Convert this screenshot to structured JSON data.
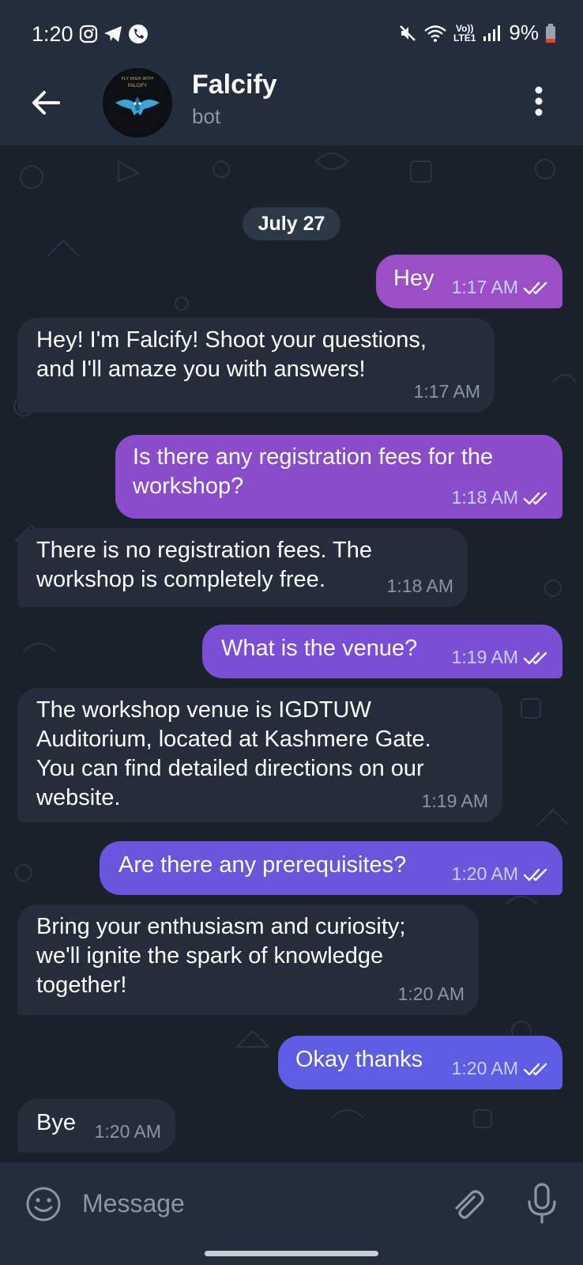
{
  "status_bar": {
    "time": "1:20",
    "battery": "9%",
    "network_top": "Vo))",
    "network_bottom": "LTE1"
  },
  "header": {
    "title": "Falcify",
    "subtitle": "bot",
    "avatar_text_line1": "FLY HIGH WITH",
    "avatar_text_line2": "FALCIFY"
  },
  "chat": {
    "date": "July 27",
    "messages": [
      {
        "direction": "out",
        "text": "Hey",
        "time": "1:17 AM",
        "color": "#9a4fc7"
      },
      {
        "direction": "in",
        "lines": [
          "Hey! I'm Falcify! Shoot your questions,",
          "and I'll amaze you with answers!"
        ],
        "time": "1:17 AM"
      },
      {
        "direction": "out",
        "lines": [
          "Is there any registration fees for the",
          "workshop?"
        ],
        "time": "1:18 AM",
        "color": "#8a4ccb"
      },
      {
        "direction": "in",
        "lines": [
          "There is no registration fees. The",
          "workshop is completely free."
        ],
        "time": "1:18 AM"
      },
      {
        "direction": "out",
        "text": "What is the venue?",
        "time": "1:19 AM",
        "color": "#7a4fd6"
      },
      {
        "direction": "in",
        "lines": [
          "The workshop venue is IGDTUW",
          "Auditorium, located at Kashmere Gate.",
          "You can find detailed directions on our",
          "website."
        ],
        "time": "1:19 AM"
      },
      {
        "direction": "out",
        "text": "Are there any prerequisites?",
        "time": "1:20 AM",
        "color": "#6a55dd"
      },
      {
        "direction": "in",
        "lines": [
          "Bring your enthusiasm and curiosity;",
          "we'll ignite the spark of knowledge",
          "together!"
        ],
        "time": "1:20 AM"
      },
      {
        "direction": "out",
        "text": "Okay thanks",
        "time": "1:20 AM",
        "color": "#5d5ce4"
      },
      {
        "direction": "in",
        "text": "Bye",
        "time": "1:20 AM"
      }
    ]
  },
  "input": {
    "placeholder": "Message"
  },
  "icons": {
    "back": "arrow-left-icon",
    "menu": "more-vertical-icon",
    "emoji": "smiley-icon",
    "attach": "paperclip-icon",
    "mic": "microphone-icon",
    "read": "double-check-icon"
  }
}
